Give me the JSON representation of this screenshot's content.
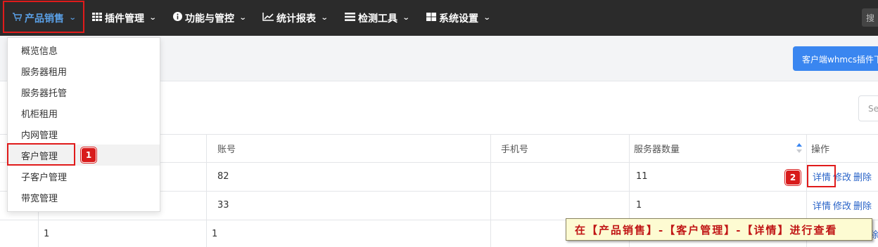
{
  "nav": {
    "items": [
      {
        "label": "产品销售",
        "icon": "cart-icon"
      },
      {
        "label": "插件管理",
        "icon": "grid-icon"
      },
      {
        "label": "功能与管控",
        "icon": "info-circle-icon"
      },
      {
        "label": "统计报表",
        "icon": "line-chart-icon"
      },
      {
        "label": "检测工具",
        "icon": "list-icon"
      },
      {
        "label": "系统设置",
        "icon": "windows-icon"
      }
    ],
    "search_stub": "搜"
  },
  "toolbar": {
    "plugin_button": "客户端whmcs插件下"
  },
  "filter": {
    "placeholder": "Se"
  },
  "table": {
    "headers": [
      "账号",
      "手机号",
      "服务器数量",
      "操作"
    ],
    "rows": [
      {
        "id": "",
        "account": "82",
        "phone": "",
        "servers": "11",
        "actions": [
          "详情",
          "修改",
          "删除"
        ]
      },
      {
        "id": "",
        "account": "33",
        "phone": "",
        "servers": "1",
        "actions": [
          "详情",
          "修改",
          "删除"
        ]
      },
      {
        "id": "1",
        "account": "1",
        "phone": "",
        "servers": "",
        "actions": [
          "",
          "",
          "除"
        ]
      }
    ]
  },
  "dropdown": {
    "items": [
      "概览信息",
      "服务器租用",
      "服务器托管",
      "机柜租用",
      "内网管理",
      "客户管理",
      "子客户管理",
      "带宽管理"
    ]
  },
  "badges": [
    "1",
    "2"
  ],
  "callout": "在【产品销售】-【客户管理】-【详情】进行查看",
  "colors": {
    "nav_bg": "#2b2b2b",
    "nav_active": "#5aa0e6",
    "primary_button": "#3a86f0",
    "link": "#2a64c8",
    "annotation_red": "#d81b1b",
    "callout_bg": "#fdfbd2"
  }
}
